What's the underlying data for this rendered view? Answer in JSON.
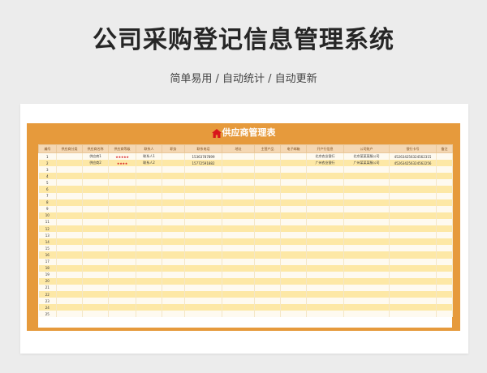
{
  "header": {
    "title": "公司采购登记信息管理系统",
    "subtitle": "简单易用 / 自动统计 / 自动更新"
  },
  "sheet": {
    "title": "供应商管理表",
    "home_icon": "home-icon",
    "columns": [
      "编号",
      "供应商分类",
      "供应商名称",
      "供应商等级",
      "联系人",
      "职务",
      "联系电话",
      "地址",
      "主营产品",
      "电子邮箱",
      "开户行信息",
      "公司账户",
      "银行卡号",
      "备注"
    ],
    "rows": [
      [
        "1",
        "",
        "供应商1",
        "★★★★★",
        "联系人1",
        "",
        "15363787899",
        "",
        "",
        "",
        "北京农业银行",
        "北京某某某服公司",
        "452634256324562315",
        ""
      ],
      [
        "2",
        "",
        "供应商2",
        "★★★★",
        "联系人2",
        "",
        "15772591882",
        "",
        "",
        "",
        "广州农业银行",
        "广州某某某服公司",
        "452634256324562256",
        ""
      ],
      [
        "3",
        "",
        "",
        "",
        "",
        "",
        "",
        "",
        "",
        "",
        "",
        "",
        "",
        ""
      ],
      [
        "4",
        "",
        "",
        "",
        "",
        "",
        "",
        "",
        "",
        "",
        "",
        "",
        "",
        ""
      ],
      [
        "5",
        "",
        "",
        "",
        "",
        "",
        "",
        "",
        "",
        "",
        "",
        "",
        "",
        ""
      ],
      [
        "6",
        "",
        "",
        "",
        "",
        "",
        "",
        "",
        "",
        "",
        "",
        "",
        "",
        ""
      ],
      [
        "7",
        "",
        "",
        "",
        "",
        "",
        "",
        "",
        "",
        "",
        "",
        "",
        "",
        ""
      ],
      [
        "8",
        "",
        "",
        "",
        "",
        "",
        "",
        "",
        "",
        "",
        "",
        "",
        "",
        ""
      ],
      [
        "9",
        "",
        "",
        "",
        "",
        "",
        "",
        "",
        "",
        "",
        "",
        "",
        "",
        ""
      ],
      [
        "10",
        "",
        "",
        "",
        "",
        "",
        "",
        "",
        "",
        "",
        "",
        "",
        "",
        ""
      ],
      [
        "11",
        "",
        "",
        "",
        "",
        "",
        "",
        "",
        "",
        "",
        "",
        "",
        "",
        ""
      ],
      [
        "12",
        "",
        "",
        "",
        "",
        "",
        "",
        "",
        "",
        "",
        "",
        "",
        "",
        ""
      ],
      [
        "13",
        "",
        "",
        "",
        "",
        "",
        "",
        "",
        "",
        "",
        "",
        "",
        "",
        ""
      ],
      [
        "14",
        "",
        "",
        "",
        "",
        "",
        "",
        "",
        "",
        "",
        "",
        "",
        "",
        ""
      ],
      [
        "15",
        "",
        "",
        "",
        "",
        "",
        "",
        "",
        "",
        "",
        "",
        "",
        "",
        ""
      ],
      [
        "16",
        "",
        "",
        "",
        "",
        "",
        "",
        "",
        "",
        "",
        "",
        "",
        "",
        ""
      ],
      [
        "17",
        "",
        "",
        "",
        "",
        "",
        "",
        "",
        "",
        "",
        "",
        "",
        "",
        ""
      ],
      [
        "18",
        "",
        "",
        "",
        "",
        "",
        "",
        "",
        "",
        "",
        "",
        "",
        "",
        ""
      ],
      [
        "19",
        "",
        "",
        "",
        "",
        "",
        "",
        "",
        "",
        "",
        "",
        "",
        "",
        ""
      ],
      [
        "20",
        "",
        "",
        "",
        "",
        "",
        "",
        "",
        "",
        "",
        "",
        "",
        "",
        ""
      ],
      [
        "21",
        "",
        "",
        "",
        "",
        "",
        "",
        "",
        "",
        "",
        "",
        "",
        "",
        ""
      ],
      [
        "22",
        "",
        "",
        "",
        "",
        "",
        "",
        "",
        "",
        "",
        "",
        "",
        "",
        ""
      ],
      [
        "23",
        "",
        "",
        "",
        "",
        "",
        "",
        "",
        "",
        "",
        "",
        "",
        "",
        ""
      ],
      [
        "24",
        "",
        "",
        "",
        "",
        "",
        "",
        "",
        "",
        "",
        "",
        "",
        "",
        ""
      ],
      [
        "25",
        "",
        "",
        "",
        "",
        "",
        "",
        "",
        "",
        "",
        "",
        "",
        "",
        ""
      ]
    ]
  },
  "colors": {
    "frame": "#e69a3c",
    "row_odd": "#fefaf0",
    "row_even": "#fde8a6",
    "stars": "#d8161b",
    "home_icon": "#d8161b"
  }
}
